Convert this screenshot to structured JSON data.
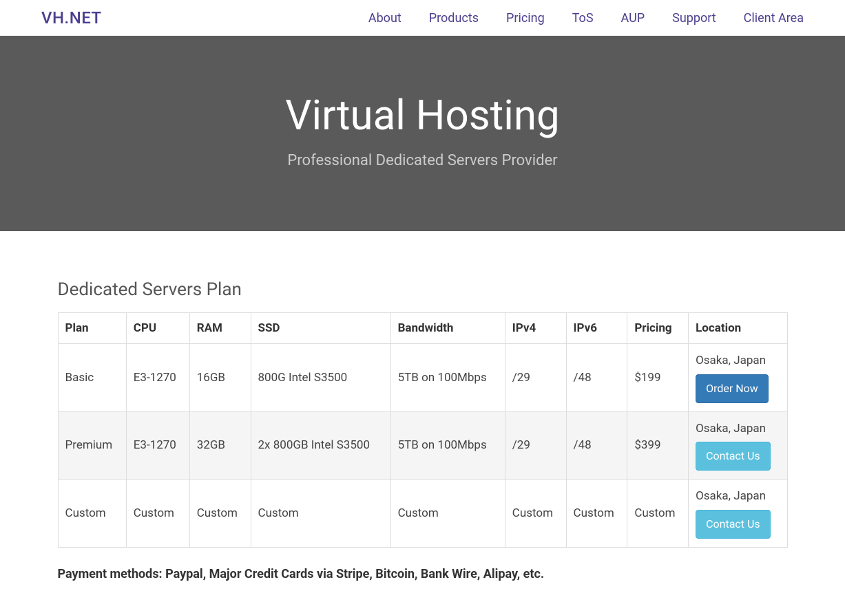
{
  "nav": {
    "brand": "VH.NET",
    "items": [
      {
        "label": "About"
      },
      {
        "label": "Products"
      },
      {
        "label": "Pricing"
      },
      {
        "label": "ToS"
      },
      {
        "label": "AUP"
      },
      {
        "label": "Support"
      },
      {
        "label": "Client Area"
      }
    ]
  },
  "hero": {
    "title": "Virtual Hosting",
    "subtitle": "Professional Dedicated Servers Provider"
  },
  "plans": {
    "title": "Dedicated Servers Plan",
    "headers": [
      "Plan",
      "CPU",
      "RAM",
      "SSD",
      "Bandwidth",
      "IPv4",
      "IPv6",
      "Pricing",
      "Location"
    ],
    "rows": [
      {
        "plan": "Basic",
        "cpu": "E3-1270",
        "ram": "16GB",
        "ssd": "800G Intel S3500",
        "bandwidth": "5TB on 100Mbps",
        "ipv4": "/29",
        "ipv6": "/48",
        "pricing": "$199",
        "location": "Osaka, Japan",
        "button": {
          "label": "Order Now",
          "variant": "primary"
        }
      },
      {
        "plan": "Premium",
        "cpu": "E3-1270",
        "ram": "32GB",
        "ssd": "2x 800GB Intel S3500",
        "bandwidth": "5TB on 100Mbps",
        "ipv4": "/29",
        "ipv6": "/48",
        "pricing": "$399",
        "location": "Osaka, Japan",
        "button": {
          "label": "Contact Us",
          "variant": "info"
        }
      },
      {
        "plan": "Custom",
        "cpu": "Custom",
        "ram": "Custom",
        "ssd": "Custom",
        "bandwidth": "Custom",
        "ipv4": "Custom",
        "ipv6": "Custom",
        "pricing": "Custom",
        "location": "Osaka, Japan",
        "button": {
          "label": "Contact Us",
          "variant": "info"
        }
      }
    ]
  },
  "payment": "Payment methods: Paypal, Major Credit Cards via Stripe, Bitcoin, Bank Wire, Alipay, etc."
}
